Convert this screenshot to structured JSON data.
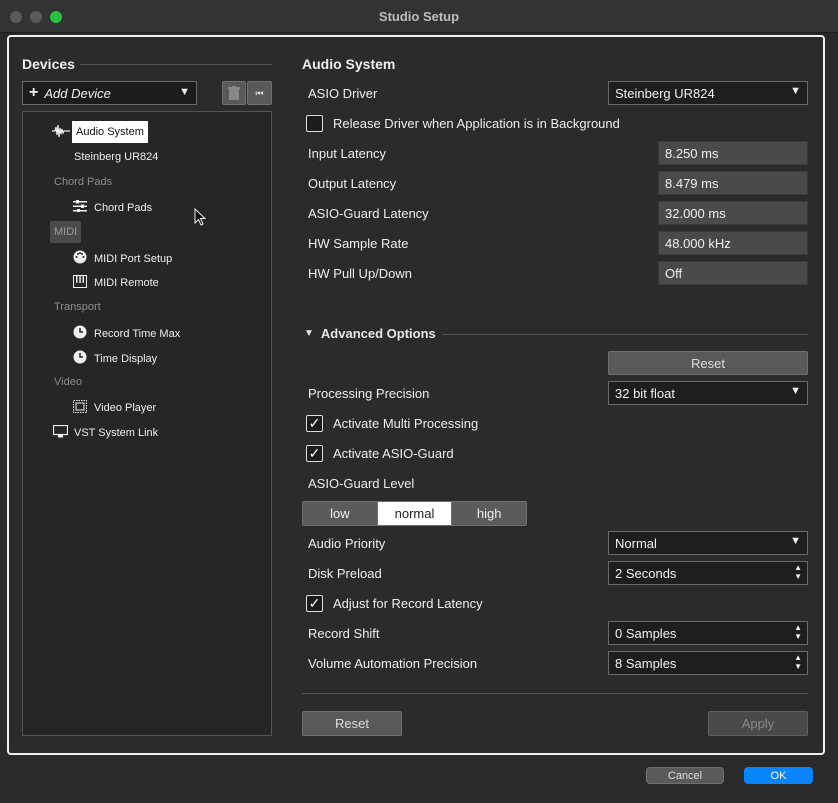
{
  "window": {
    "title": "Studio Setup"
  },
  "sidebar": {
    "heading": "Devices",
    "add_device": "Add Device",
    "tree": [
      {
        "label": "Audio System",
        "icon": "waveform-icon",
        "selected": true
      },
      {
        "label": "Steinberg UR824"
      },
      {
        "label": "Chord Pads",
        "category": true
      },
      {
        "label": "Chord Pads",
        "icon": "sliders-icon"
      },
      {
        "label": "MIDI",
        "category": true
      },
      {
        "label": "MIDI Port Setup",
        "icon": "midi-port-icon"
      },
      {
        "label": "MIDI Remote",
        "icon": "keyboard-icon"
      },
      {
        "label": "Transport",
        "category": true
      },
      {
        "label": "Record Time Max",
        "icon": "clock-icon"
      },
      {
        "label": "Time Display",
        "icon": "clock-icon"
      },
      {
        "label": "Video",
        "category": true
      },
      {
        "label": "Video Player",
        "icon": "film-icon"
      },
      {
        "label": "VST System Link",
        "icon": "monitor-icon"
      }
    ]
  },
  "audio": {
    "heading": "Audio System",
    "asio_driver_label": "ASIO Driver",
    "asio_driver_value": "Steinberg UR824",
    "release_driver_label": "Release Driver when Application is in Background",
    "release_driver_checked": false,
    "input_latency_label": "Input Latency",
    "input_latency_value": "8.250 ms",
    "output_latency_label": "Output Latency",
    "output_latency_value": "8.479 ms",
    "asio_guard_latency_label": "ASIO-Guard Latency",
    "asio_guard_latency_value": "32.000 ms",
    "hw_sample_rate_label": "HW Sample Rate",
    "hw_sample_rate_value": "48.000 kHz",
    "hw_pull_label": "HW Pull Up/Down",
    "hw_pull_value": "Off"
  },
  "advanced": {
    "heading": "Advanced Options",
    "reset_label": "Reset",
    "processing_precision_label": "Processing Precision",
    "processing_precision_value": "32 bit float",
    "multi_processing_label": "Activate Multi Processing",
    "asio_guard_label": "Activate ASIO-Guard",
    "asio_guard_level_label": "ASIO-Guard Level",
    "levels": [
      "low",
      "normal",
      "high"
    ],
    "selected_level": "normal",
    "audio_priority_label": "Audio Priority",
    "audio_priority_value": "Normal",
    "disk_preload_label": "Disk Preload",
    "disk_preload_value": "2 Seconds",
    "adjust_record_latency_label": "Adjust for Record Latency",
    "record_shift_label": "Record Shift",
    "record_shift_value": "0 Samples",
    "volume_automation_label": "Volume Automation Precision",
    "volume_automation_value": "8 Samples"
  },
  "footer": {
    "reset_label": "Reset",
    "apply_label": "Apply",
    "cancel_label": "Cancel",
    "ok_label": "OK"
  },
  "colors": {
    "accent": "#0a84ff",
    "selection_bg": "#ffffff"
  }
}
